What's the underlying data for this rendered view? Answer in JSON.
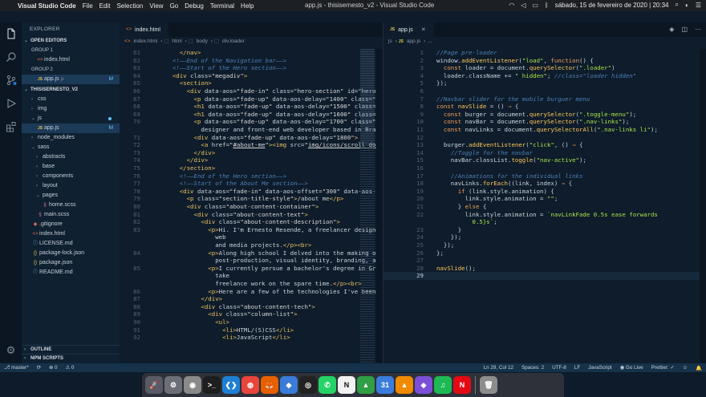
{
  "menubar": {
    "apple": "",
    "app_name": "Visual Studio Code",
    "items": [
      "File",
      "Edit",
      "Selection",
      "View",
      "Go",
      "Debug",
      "Terminal",
      "Help"
    ],
    "window_title": "app.js - thisisernesto_v2 - Visual Studio Code",
    "clock": "sábado, 15 de fevereiro de 2020",
    "time": "20:34"
  },
  "sidebar": {
    "title": "EXPLORER",
    "open_editors": "OPEN EDITORS",
    "group1": "GROUP 1",
    "group1_file": "index.html",
    "group2": "GROUP 2",
    "group2_file": "app.js",
    "group2_path": "js",
    "group2_badge": "M",
    "project": "THISISERNESTO_V2",
    "tree": [
      {
        "label": "css",
        "indent": 1,
        "kind": "folder"
      },
      {
        "label": "img",
        "indent": 1,
        "kind": "folder"
      },
      {
        "label": "js",
        "indent": 1,
        "kind": "folder-open",
        "dot": true
      },
      {
        "label": "app.js",
        "indent": 2,
        "kind": "js",
        "badge": "M",
        "selected": true
      },
      {
        "label": "node_modules",
        "indent": 1,
        "kind": "folder"
      },
      {
        "label": "sass",
        "indent": 1,
        "kind": "folder-open"
      },
      {
        "label": "abstracts",
        "indent": 2,
        "kind": "folder"
      },
      {
        "label": "base",
        "indent": 2,
        "kind": "folder"
      },
      {
        "label": "components",
        "indent": 2,
        "kind": "folder"
      },
      {
        "label": "layout",
        "indent": 2,
        "kind": "folder"
      },
      {
        "label": "pages",
        "indent": 2,
        "kind": "folder-open"
      },
      {
        "label": "home.scss",
        "indent": 3,
        "kind": "sass"
      },
      {
        "label": "main.scss",
        "indent": 2,
        "kind": "sass"
      },
      {
        "label": ".gitignore",
        "indent": 1,
        "kind": "git"
      },
      {
        "label": "index.html",
        "indent": 1,
        "kind": "html"
      },
      {
        "label": "LICENSE.md",
        "indent": 1,
        "kind": "txt"
      },
      {
        "label": "package-lock.json",
        "indent": 1,
        "kind": "json"
      },
      {
        "label": "package.json",
        "indent": 1,
        "kind": "json"
      },
      {
        "label": "README.md",
        "indent": 1,
        "kind": "txt"
      }
    ],
    "outline": "OUTLINE",
    "npm": "NPM SCRIPTS"
  },
  "editor1": {
    "tab": "index.html",
    "crumbs": [
      "index.html",
      "html",
      "body",
      "div.loader"
    ],
    "lines": [
      {
        "n": "61",
        "h": "      <span class='tag'>&lt;/nav&gt;</span>"
      },
      {
        "n": "62",
        "h": "    <span class='cm'>&lt;!——End of the Navigation bar——&gt;</span>"
      },
      {
        "n": "63",
        "h": "    <span class='cm'>&lt;!——Start of the Hero section——&gt;</span>"
      },
      {
        "n": "64",
        "h": "    <span class='tag'>&lt;div</span> <span class='an'>class=</span><span class='sv'>\"megadiv\"</span><span class='tag'>&gt;</span>"
      },
      {
        "n": "65",
        "h": "      <span class='tag'>&lt;section&gt;</span>"
      },
      {
        "n": "66",
        "h": "        <span class='tag'>&lt;div</span> <span class='an'>data-aos=</span><span class='sv'>\"fade-in\"</span> <span class='an'>class=</span><span class='sv'>\"hero-section\"</span> <span class='an'>id=</span><span class='sv'>\"hero</span>"
      },
      {
        "n": "67",
        "h": "          <span class='tag'>&lt;p</span> <span class='an'>data-aos=</span><span class='sv'>\"fade-up\"</span> <span class='an'>data-aos-delay=</span><span class='sv'>\"1400\"</span> <span class='an'>class=</span><span class='sv'>\"</span>"
      },
      {
        "n": "68",
        "h": "          <span class='tag'>&lt;h1</span> <span class='an'>data-aos=</span><span class='sv'>\"fade-up\"</span> <span class='an'>data-aos-delay=</span><span class='sv'>\"1500\"</span> <span class='an'>class=</span><span class='sv'>\"</span>"
      },
      {
        "n": "69",
        "h": "          <span class='tag'>&lt;h1</span> <span class='an'>data-aos=</span><span class='sv'>\"fade-up\"</span> <span class='an'>data-aos-delay=</span><span class='sv'>\"1600\"</span> <span class='an'>class=</span><span class='sv'>\"</span>"
      },
      {
        "n": "70",
        "h": "          <span class='tag'>&lt;p</span> <span class='an'>data-aos=</span><span class='sv'>\"fade-up\"</span> <span class='an'>data-aos-delay=</span><span class='sv'>\"1700\"</span> <span class='an'>class=</span><span class='sv'>\"</span>"
      },
      {
        "n": "",
        "h": "            designer and front-end web developer based in Bra"
      },
      {
        "n": "71",
        "h": "          <span class='tag'>&lt;div</span> <span class='an'>data-aos=</span><span class='sv'>\"fade-up\"</span> <span class='an'>data-aos-delay=</span><span class='sv'>\"1800\"</span><span class='tag'>&gt;</span>"
      },
      {
        "n": "72",
        "h": "            <span class='tag'>&lt;a</span> <span class='an'>href=</span><span class='sv'>\"<u>#about-me</u>\"</span><span class='tag'>&gt;&lt;img</span> <span class='an'>src=</span><span class='sv'>\"<u>img/icons/scroll_do</u></span>"
      },
      {
        "n": "73",
        "h": "          <span class='tag'>&lt;/div&gt;</span>"
      },
      {
        "n": "74",
        "h": "        <span class='tag'>&lt;/div&gt;</span>"
      },
      {
        "n": "75",
        "h": "      <span class='tag'>&lt;/section&gt;</span>"
      },
      {
        "n": "76",
        "h": "      <span class='cm'>&lt;!——End of the Hero section——&gt;</span>"
      },
      {
        "n": "77",
        "h": "      <span class='cm'>&lt;!——Start of the About Me section——&gt;</span>"
      },
      {
        "n": "78",
        "h": "      <span class='tag'>&lt;div</span> <span class='an'>data-aos=</span><span class='sv'>\"fade-in\"</span> <span class='an'>data-aos-offset=</span><span class='sv'>\"300\"</span> <span class='an'>data-aos-</span>"
      },
      {
        "n": "79",
        "h": "        <span class='tag'>&lt;p</span> <span class='an'>class=</span><span class='sv'>\"section-title-style\"</span><span class='tag'>&gt;</span>/about me<span class='tag'>&lt;/p&gt;</span>"
      },
      {
        "n": "80",
        "h": "        <span class='tag'>&lt;div</span> <span class='an'>class=</span><span class='sv'>\"about-content-container\"</span><span class='tag'>&gt;</span>"
      },
      {
        "n": "81",
        "h": "          <span class='tag'>&lt;div</span> <span class='an'>class=</span><span class='sv'>\"about-content-text\"</span><span class='tag'>&gt;</span>"
      },
      {
        "n": "82",
        "h": "            <span class='tag'>&lt;div</span> <span class='an'>class=</span><span class='sv'>\"about-content-description\"</span><span class='tag'>&gt;</span>"
      },
      {
        "n": "83",
        "h": "              <span class='tag'>&lt;p&gt;</span>Hi. I'm Ernesto Resende, a freelancer design"
      },
      {
        "n": "",
        "h": "                web"
      },
      {
        "n": "",
        "h": "                and media projects.<span class='tag'>&lt;/p&gt;&lt;br&gt;</span>"
      },
      {
        "n": "84",
        "h": "              <span class='tag'>&lt;p&gt;</span>Along high school I delved into the making o"
      },
      {
        "n": "",
        "h": "                post-production, visual identity, branding, a"
      },
      {
        "n": "85",
        "h": "              <span class='tag'>&lt;p&gt;</span>I currently persue a bachelor's degree in Gr"
      },
      {
        "n": "",
        "h": "                take"
      },
      {
        "n": "",
        "h": "                freelance work on the spare time.<span class='tag'>&lt;/p&gt;&lt;br&gt;</span>"
      },
      {
        "n": "86",
        "h": "              <span class='tag'>&lt;p&gt;</span>Here are a few of the technologies I've been"
      },
      {
        "n": "87",
        "h": "            <span class='tag'>&lt;/div&gt;</span>"
      },
      {
        "n": "88",
        "h": "            <span class='tag'>&lt;div</span> <span class='an'>class=</span><span class='sv'>\"about-content-tech\"</span><span class='tag'>&gt;</span>"
      },
      {
        "n": "89",
        "h": "              <span class='tag'>&lt;div</span> <span class='an'>class=</span><span class='sv'>\"column-list\"</span><span class='tag'>&gt;</span>"
      },
      {
        "n": "90",
        "h": "                <span class='tag'>&lt;ul&gt;</span>"
      },
      {
        "n": "91",
        "h": "                  <span class='tag'>&lt;li&gt;</span>HTML/(S)CSS<span class='tag'>&lt;/li&gt;</span>"
      },
      {
        "n": "92",
        "h": "                  <span class='tag'>&lt;li&gt;</span>JavaScript<span class='tag'>&lt;/li&gt;</span>"
      }
    ]
  },
  "editor2": {
    "tab": "app.js",
    "crumbs": [
      "js",
      "app.js",
      "…"
    ],
    "lines": [
      {
        "n": "1",
        "h": "<span class='cm'>//Page pre-loader</span>"
      },
      {
        "n": "2",
        "h": "window.<span class='fn'>addEventListener</span>(<span class='st'>\"load\"</span>, <span class='kw'>function</span>() {"
      },
      {
        "n": "3",
        "h": "  <span class='kw'>const</span> loader = document.<span class='fn'>querySelector</span>(<span class='st'>\".loader\"</span>)"
      },
      {
        "n": "4",
        "h": "  loader.className += <span class='st'>\" hidden\"</span>; <span class='cm'>//class=\"loader hidden\"</span>"
      },
      {
        "n": "5",
        "h": "});"
      },
      {
        "n": "6",
        "h": ""
      },
      {
        "n": "7",
        "h": "<span class='cm'>//Navbar slider for the mobile burguer menu</span>"
      },
      {
        "n": "8",
        "h": "<span class='kw'>const</span> <span class='fn'>navSlide</span> = () <span class='kw'>⇒</span> {"
      },
      {
        "n": "9",
        "h": "  <span class='kw'>const</span> burger = document.<span class='fn'>querySelector</span>(<span class='st'>\".toggle-menu\"</span>);"
      },
      {
        "n": "10",
        "h": "  <span class='kw'>const</span> navBar = document.<span class='fn'>querySelector</span>(<span class='st'>\".nav-links\"</span>);"
      },
      {
        "n": "11",
        "h": "  <span class='kw'>const</span> navLinks = document.<span class='fn'>querySelectorAll</span>(<span class='st'>\".nav-links li\"</span>);"
      },
      {
        "n": "12",
        "h": ""
      },
      {
        "n": "13",
        "h": "  burger.<span class='fn'>addEventListener</span>(<span class='st'>\"click\"</span>, () <span class='kw'>⇒</span> {"
      },
      {
        "n": "14",
        "h": "    <span class='cm'>//Toggle for the navbar</span>"
      },
      {
        "n": "15",
        "h": "    navBar.classList.<span class='fn'>toggle</span>(<span class='st'>\"nav-active\"</span>);"
      },
      {
        "n": "16",
        "h": ""
      },
      {
        "n": "17",
        "h": "    <span class='cm'>//Animations for the individual links</span>"
      },
      {
        "n": "18",
        "h": "    navLinks.<span class='fn'>forEach</span>((link, index) <span class='kw'>⇒</span> {"
      },
      {
        "n": "19",
        "h": "      <span class='kw'>if</span> (link.style.animation) {"
      },
      {
        "n": "20",
        "h": "        link.style.animation = <span class='st'>\"\"</span>;"
      },
      {
        "n": "21",
        "h": "      } <span class='kw'>else</span> {"
      },
      {
        "n": "22",
        "h": "        link.style.animation = <span class='st'>`navLinkFade 0.5s ease forwards</span>"
      },
      {
        "n": "",
        "h": "          <span class='st'>0.5}s`</span>;"
      },
      {
        "n": "23",
        "h": "      }"
      },
      {
        "n": "24",
        "h": "    });"
      },
      {
        "n": "25",
        "h": "  });"
      },
      {
        "n": "26",
        "h": "};"
      },
      {
        "n": "27",
        "h": ""
      },
      {
        "n": "28",
        "h": "<span class='fn'>navSlide</span>();"
      },
      {
        "n": "29",
        "h": ""
      }
    ],
    "active_line": 29
  },
  "statusbar": {
    "branch": "master*",
    "sync": "⟳",
    "errors": "⊗ 0",
    "warnings": "⚠ 0",
    "position": "Ln 29, Col 12",
    "spaces": "Spaces: 2",
    "encoding": "UTF-8",
    "eol": "LF",
    "language": "JavaScript",
    "golive": "◉ Go Live",
    "prettier": "Prettier: ✓"
  },
  "dock": [
    {
      "name": "launchpad",
      "glyph": "🚀",
      "color": "#5a5a66"
    },
    {
      "name": "system-preferences",
      "glyph": "⚙",
      "color": "#6c6f76"
    },
    {
      "name": "disk-utility",
      "glyph": "◉",
      "color": "#8a8a8a"
    },
    {
      "name": "terminal",
      "glyph": ">_",
      "color": "#1e1e1e"
    },
    {
      "name": "visual-studio-code",
      "glyph": "❮❯",
      "color": "#1e7fd4"
    },
    {
      "name": "chrome",
      "glyph": "◍",
      "color": "#e8453c"
    },
    {
      "name": "firefox",
      "glyph": "🦊",
      "color": "#e66000"
    },
    {
      "name": "transmit",
      "glyph": "◆",
      "color": "#3a7cd8"
    },
    {
      "name": "obs",
      "glyph": "◎",
      "color": "#222"
    },
    {
      "name": "whatsapp",
      "glyph": "✆",
      "color": "#25d366"
    },
    {
      "name": "notion",
      "glyph": "N",
      "color": "#f2f2f2"
    },
    {
      "name": "google-drive",
      "glyph": "▲",
      "color": "#2f9e44"
    },
    {
      "name": "calendar",
      "glyph": "31",
      "color": "#3b7ddd"
    },
    {
      "name": "vlc",
      "glyph": "▲",
      "color": "#f08a00"
    },
    {
      "name": "affinity",
      "glyph": "◈",
      "color": "#7b4fd8"
    },
    {
      "name": "spotify",
      "glyph": "♫",
      "color": "#1db954"
    },
    {
      "name": "netflix",
      "glyph": "N",
      "color": "#e50914"
    },
    {
      "name": "trash",
      "glyph": "🗑",
      "color": "#8d8d8d"
    }
  ]
}
